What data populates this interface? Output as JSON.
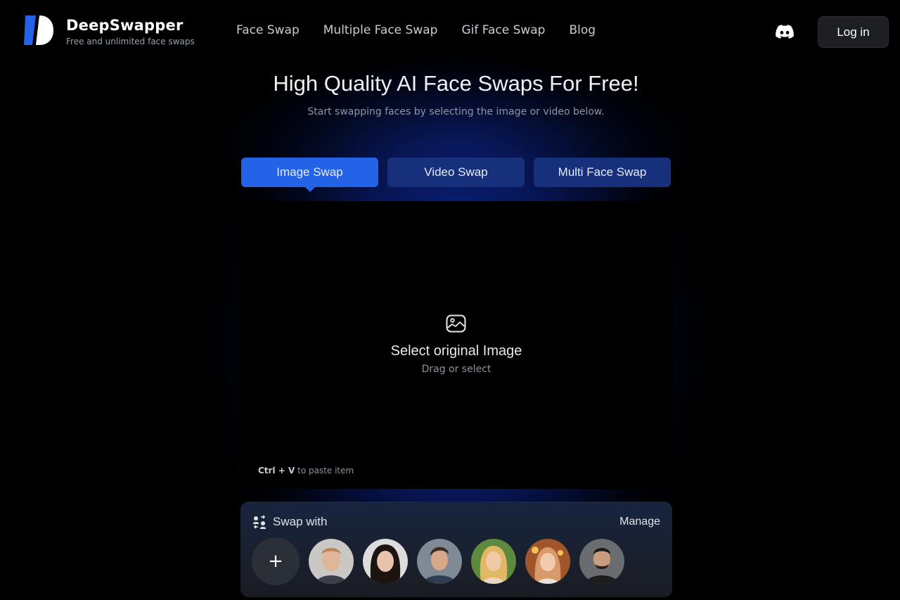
{
  "brand": {
    "name": "DeepSwapper",
    "tagline": "Free and unlimited face swaps"
  },
  "nav": [
    {
      "label": "Face Swap"
    },
    {
      "label": "Multiple Face Swap"
    },
    {
      "label": "Gif Face Swap"
    },
    {
      "label": "Blog"
    }
  ],
  "header": {
    "discord_icon": "discord-icon",
    "login_label": "Log in"
  },
  "hero": {
    "title": "High Quality AI Face Swaps For Free!",
    "subtitle": "Start swapping faces by selecting the image or video below."
  },
  "tabs": [
    {
      "label": "Image Swap",
      "active": true
    },
    {
      "label": "Video Swap",
      "active": false
    },
    {
      "label": "Multi Face Swap",
      "active": false
    }
  ],
  "upload": {
    "icon": "image-icon",
    "title": "Select original Image",
    "subtitle": "Drag or select",
    "paste_key": "Ctrl + V",
    "paste_text": "to paste item"
  },
  "swap_with": {
    "title": "Swap with",
    "manage_label": "Manage",
    "add_label": "+",
    "faces": [
      {
        "name": "face-1"
      },
      {
        "name": "face-2"
      },
      {
        "name": "face-3"
      },
      {
        "name": "face-4"
      },
      {
        "name": "face-5"
      },
      {
        "name": "face-6"
      }
    ]
  },
  "colors": {
    "accent": "#2462e8",
    "tab_inactive": "#16307c",
    "background": "#000000",
    "glow": "#1644e6"
  }
}
